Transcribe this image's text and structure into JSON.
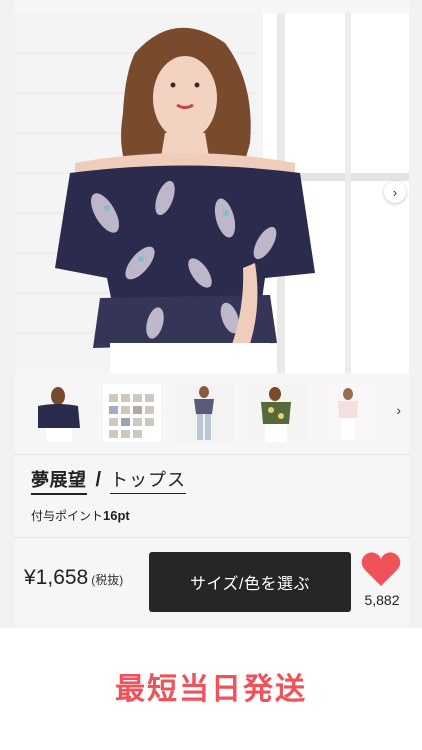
{
  "product": {
    "brand": "夢展望",
    "separator": "/",
    "category": "トップス",
    "points_prefix": "付与ポイント",
    "points_value": "16pt",
    "price": "¥1,658",
    "tax_note": "(税抜)",
    "select_button": "サイズ/色を選ぶ",
    "likes": "5,882"
  },
  "gallery": {
    "next_icon": "chevron-right-icon",
    "thumbnails": [
      "thumb-1",
      "thumb-2",
      "thumb-3",
      "thumb-4",
      "thumb-5"
    ]
  },
  "banner": {
    "text": "最短当日発送"
  },
  "colors": {
    "accent": "#f0525a",
    "button": "#262626",
    "heart": "#f0525a"
  }
}
